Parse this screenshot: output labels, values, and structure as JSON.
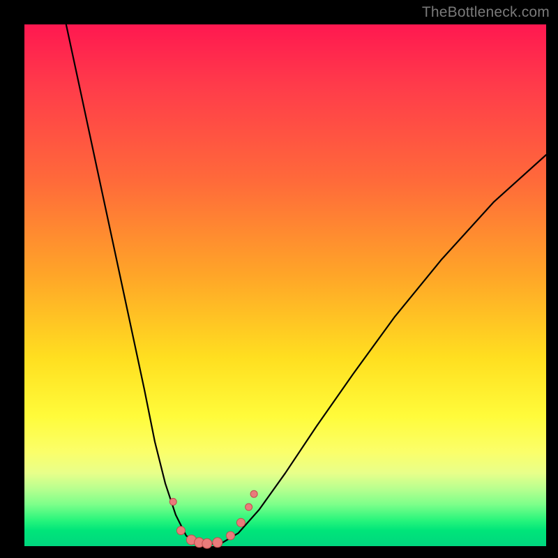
{
  "watermark": "TheBottleneck.com",
  "colors": {
    "frame": "#000000",
    "gradient_top": "#ff1850",
    "gradient_mid": "#ffdf20",
    "gradient_bottom": "#00d77e",
    "curve": "#000000",
    "marker_fill": "#e97b7b",
    "marker_stroke": "#c14d4d"
  },
  "chart_data": {
    "type": "line",
    "title": "",
    "xlabel": "",
    "ylabel": "",
    "xrange": [
      0,
      100
    ],
    "yrange": [
      0,
      100
    ],
    "note": "Axes unlabeled; values are relative 0–100. y increases upward; lower y = better (green).",
    "series": [
      {
        "name": "left-curve",
        "points": [
          {
            "x": 8,
            "y": 100
          },
          {
            "x": 11,
            "y": 86
          },
          {
            "x": 14,
            "y": 72
          },
          {
            "x": 17,
            "y": 58
          },
          {
            "x": 20,
            "y": 44
          },
          {
            "x": 23,
            "y": 30
          },
          {
            "x": 25,
            "y": 20
          },
          {
            "x": 27,
            "y": 12
          },
          {
            "x": 29,
            "y": 6
          },
          {
            "x": 31,
            "y": 2
          },
          {
            "x": 33,
            "y": 0.6
          },
          {
            "x": 35,
            "y": 0.3
          }
        ]
      },
      {
        "name": "right-curve",
        "points": [
          {
            "x": 35,
            "y": 0.3
          },
          {
            "x": 38,
            "y": 0.7
          },
          {
            "x": 41,
            "y": 2.5
          },
          {
            "x": 45,
            "y": 7
          },
          {
            "x": 50,
            "y": 14
          },
          {
            "x": 56,
            "y": 23
          },
          {
            "x": 63,
            "y": 33
          },
          {
            "x": 71,
            "y": 44
          },
          {
            "x": 80,
            "y": 55
          },
          {
            "x": 90,
            "y": 66
          },
          {
            "x": 100,
            "y": 75
          }
        ]
      }
    ],
    "markers": [
      {
        "x": 28.5,
        "y": 8.5,
        "r": 5
      },
      {
        "x": 30.0,
        "y": 3.0,
        "r": 6
      },
      {
        "x": 32.0,
        "y": 1.2,
        "r": 7
      },
      {
        "x": 33.5,
        "y": 0.7,
        "r": 7
      },
      {
        "x": 35.0,
        "y": 0.5,
        "r": 7
      },
      {
        "x": 37.0,
        "y": 0.7,
        "r": 7
      },
      {
        "x": 39.5,
        "y": 2.0,
        "r": 6
      },
      {
        "x": 41.5,
        "y": 4.5,
        "r": 6
      },
      {
        "x": 43.0,
        "y": 7.5,
        "r": 5
      },
      {
        "x": 44.0,
        "y": 10.0,
        "r": 5
      }
    ]
  }
}
